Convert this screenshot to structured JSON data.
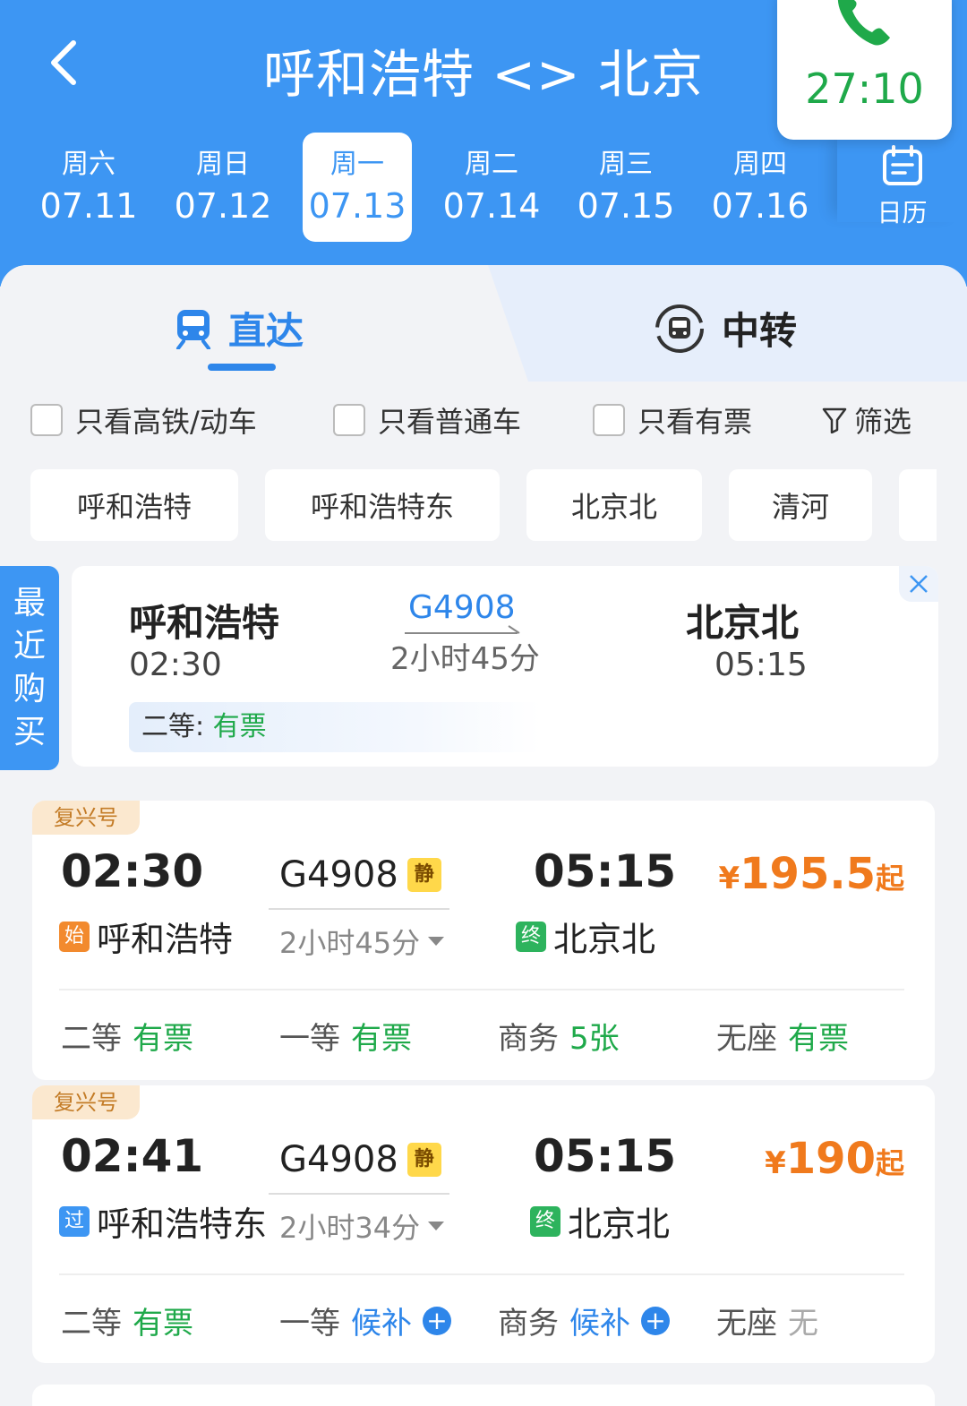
{
  "header": {
    "title": "呼和浩特 <> 北京",
    "call_timer": "27:10",
    "dates": [
      {
        "weekday": "周六",
        "date": "07.11"
      },
      {
        "weekday": "周日",
        "date": "07.12"
      },
      {
        "weekday": "周一",
        "date": "07.13",
        "selected": true
      },
      {
        "weekday": "周二",
        "date": "07.14"
      },
      {
        "weekday": "周三",
        "date": "07.15"
      },
      {
        "weekday": "周四",
        "date": "07.16"
      }
    ],
    "calendar_label": "日历"
  },
  "mode_tabs": {
    "direct": "直达",
    "transfer": "中转",
    "selected": "direct"
  },
  "filters": {
    "only_high_speed": "只看高铁/动车",
    "only_regular": "只看普通车",
    "only_available": "只看有票",
    "filter_label": "筛选"
  },
  "stations": [
    "呼和浩特",
    "呼和浩特东",
    "北京北",
    "清河"
  ],
  "recent": {
    "tag": [
      "最",
      "近",
      "购",
      "买"
    ],
    "from_station": "呼和浩特",
    "depart_time": "02:30",
    "train_no": "G4908",
    "duration": "2小时45分",
    "to_station": "北京北",
    "arrive_time": "05:15",
    "seat_label": "二等:",
    "seat_status": "有票"
  },
  "trains": [
    {
      "brand": "复兴号",
      "depart_time": "02:30",
      "from_badge": "始",
      "from_station": "呼和浩特",
      "train_no": "G4908",
      "quiet_badge": "静",
      "duration": "2小时45分",
      "arrive_time": "05:15",
      "to_badge": "终",
      "to_station": "北京北",
      "price_symbol": "¥",
      "price": "195.5",
      "price_suffix": "起",
      "seats": [
        {
          "class": "二等",
          "status": "有票"
        },
        {
          "class": "一等",
          "status": "有票"
        },
        {
          "class": "商务",
          "status": "5张"
        },
        {
          "class": "无座",
          "status": "有票"
        }
      ]
    },
    {
      "brand": "复兴号",
      "depart_time": "02:41",
      "from_badge": "过",
      "from_station": "呼和浩特东",
      "train_no": "G4908",
      "quiet_badge": "静",
      "duration": "2小时34分",
      "arrive_time": "05:15",
      "to_badge": "终",
      "to_station": "北京北",
      "price_symbol": "¥",
      "price": "190",
      "price_suffix": "起",
      "seats": [
        {
          "class": "二等",
          "status": "有票"
        },
        {
          "class": "一等",
          "status": "候补"
        },
        {
          "class": "商务",
          "status": "候补"
        },
        {
          "class": "无座",
          "status": "无"
        }
      ]
    }
  ],
  "colors": {
    "primary": "#3d96f3",
    "available": "#1fa94a",
    "waitlist": "#2e86ea",
    "price": "#f07a1d"
  }
}
